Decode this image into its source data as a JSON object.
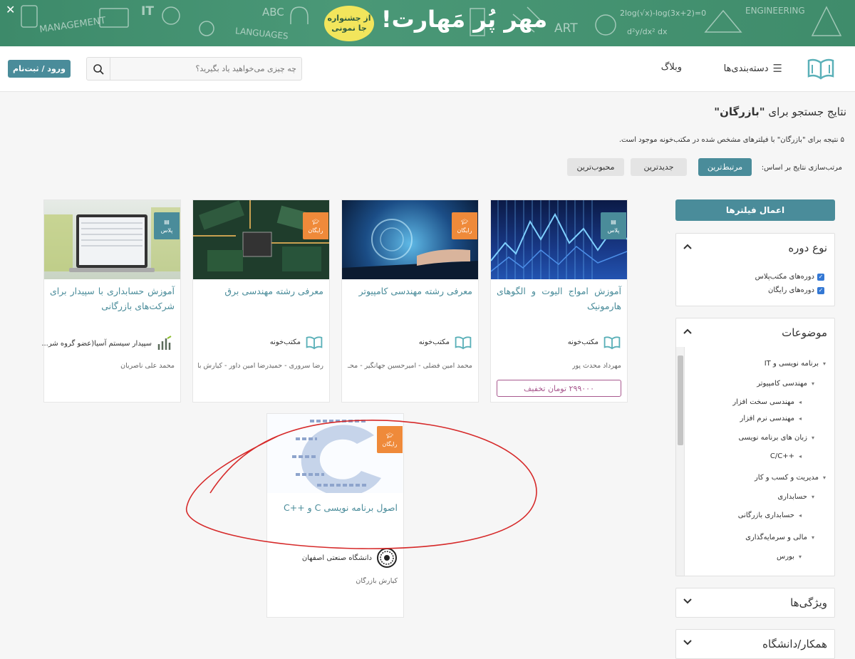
{
  "banner": {
    "close_icon": "close-icon",
    "badge": "از جشنواره\nجا نمونی",
    "headline": "مهر پُر مَهارت!",
    "doodles": [
      "MANAGEMENT",
      "IT",
      "ABC",
      "LANGUAGES",
      "ART",
      "ENGINEERING"
    ]
  },
  "header": {
    "nav_categories": "دسته‌بندی‌ها",
    "nav_blog": "وبلاگ",
    "search_placeholder": "چه چیزی می‌خواهید یاد بگیرید؟",
    "login": "ورود / ثبت‌نام"
  },
  "results": {
    "title_prefix": "نتایج جستجو برای ",
    "title_query": "\"بازرگان\"",
    "count_line": "۵ نتیجه برای \"بازرگان\" با فیلترهای مشخص شده در مکتب‌خونه موجود است.",
    "sort_label": "مرتب‌سازی نتایج بر اساس:",
    "sort_options": [
      "مرتبط‌ترین",
      "جدیدترین",
      "محبوب‌ترین"
    ]
  },
  "filters": {
    "apply": "اعمال فیلترها",
    "course_type": {
      "title": "نوع دوره",
      "options": [
        "دوره‌های مکتب‌پلاس",
        "دوره‌های رایگان"
      ]
    },
    "topics": {
      "title": "موضوعات",
      "items": [
        "برنامه نویسی و IT",
        "مهندسی کامپیوتر",
        "مهندسی سخت افزار",
        "مهندسی نرم افزار",
        "زبان های برنامه نویسی",
        "C/C++",
        "مدیریت و کسب و کار",
        "حسابداری",
        "حسابداری بازرگانی",
        "مالی و سرمایه‌گذاری",
        "بورس"
      ]
    },
    "features": {
      "title": "ویژگی‌ها"
    },
    "partner": {
      "title": "همکار/دانشگاه"
    }
  },
  "tags": {
    "free": "رایگان",
    "plus": "پلاس"
  },
  "cards": [
    {
      "title": "آموزش امواج الیوت و الگوهای هارمونیک",
      "org": "مکتب‌خونه",
      "people": "مهرداد محدث پور",
      "price": "۲۹۹۰۰۰ تومان تخفیف",
      "tag": "plus"
    },
    {
      "title": "معرفی رشته مهندسی کامپیوتر",
      "org": "مکتب‌خونه",
      "people": "محمد امین فضلی - امیرحسین جهانگیر - محـ...",
      "tag": "free"
    },
    {
      "title": "معرفی رشته مهندسی برق",
      "org": "مکتب‌خونه",
      "people": "رضا سروری - حمیدرضا امین داور - کیارش باز...",
      "tag": "free"
    },
    {
      "title": "آموزش حسابداری با سپیدار برای شرکت‌های بازرگانی",
      "org": "سپیدار سیستم آسیا(عضو گروه شر...",
      "people": "محمد علی ناصریان",
      "tag": "plus"
    },
    {
      "title": "اصول برنامه نویسی C و ++C",
      "org": "دانشگاه صنعتی اصفهان",
      "people": "کیارش بازرگان",
      "tag": "free"
    }
  ]
}
